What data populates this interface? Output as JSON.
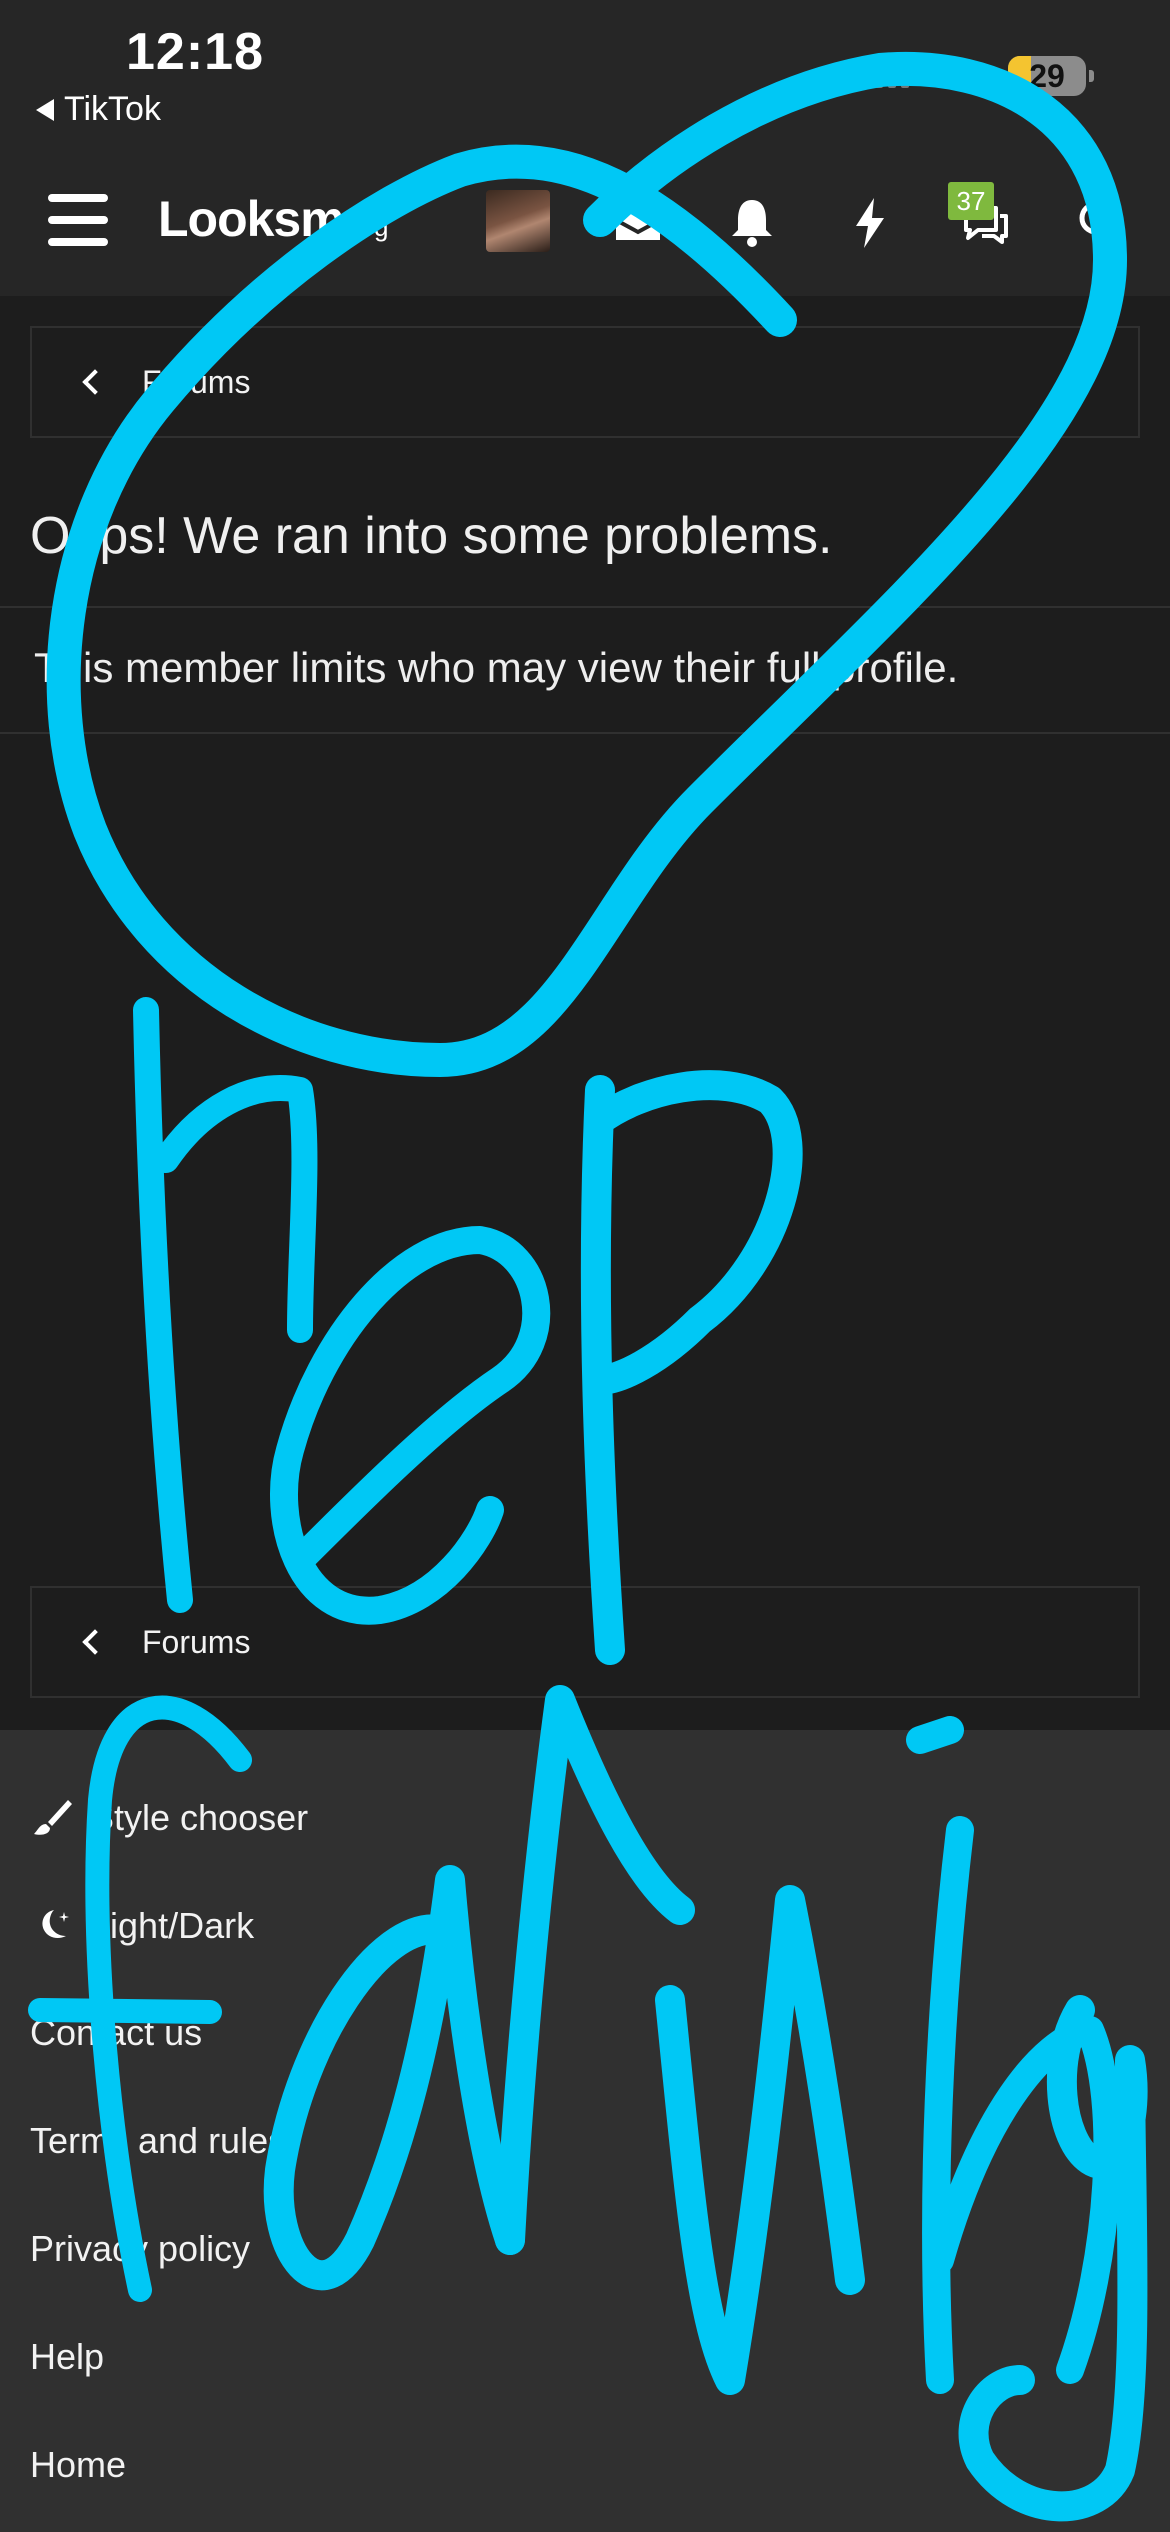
{
  "status_bar": {
    "time": "12:18",
    "back_app": "TikTok",
    "battery_level": "29"
  },
  "header": {
    "logo_main": "Looksm",
    "logo_suffix": ".org",
    "alerts_badge": "37",
    "icons": [
      "menu-icon",
      "avatar",
      "inbox-icon",
      "bell-icon",
      "lightning-icon",
      "chat-icon",
      "search-icon"
    ]
  },
  "breadcrumb_top": {
    "label": "Forums"
  },
  "error": {
    "title": "Oops! We ran into some problems.",
    "message": "This member limits who may view their full profile."
  },
  "breadcrumb_bottom": {
    "label": "Forums"
  },
  "footer": {
    "links": [
      {
        "label": "Style chooser",
        "icon": "brush-icon"
      },
      {
        "label": "Light/Dark",
        "icon": "moon-icon"
      },
      {
        "label": "Contact us"
      },
      {
        "label": "Terms and rules"
      },
      {
        "label": "Privacy policy"
      },
      {
        "label": "Help"
      },
      {
        "label": "Home"
      }
    ]
  },
  "colors": {
    "background": "#1d1d1d",
    "header": "#262626",
    "footer": "#303030",
    "badge": "#7fb93e",
    "scribble": "#00c8f5",
    "battery_accent": "#f4c430"
  }
}
